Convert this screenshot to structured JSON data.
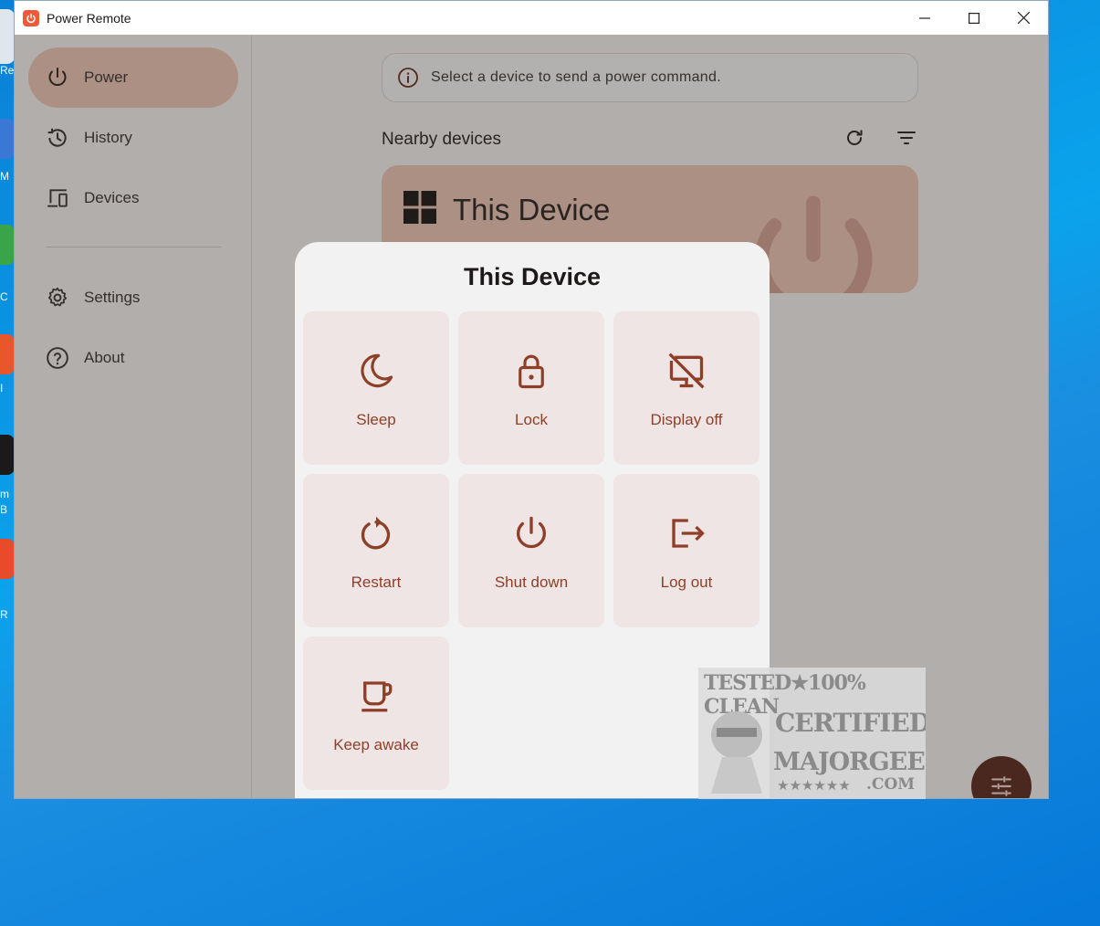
{
  "desktop": {
    "icon_labels": [
      "Re",
      "M",
      "C",
      "I",
      "m",
      "B",
      "R"
    ]
  },
  "window": {
    "title": "Power Remote",
    "controls": [
      "minimize",
      "maximize",
      "close"
    ]
  },
  "sidebar": {
    "items": [
      {
        "label": "Power",
        "icon": "power-icon",
        "active": true
      },
      {
        "label": "History",
        "icon": "history-icon",
        "active": false
      },
      {
        "label": "Devices",
        "icon": "devices-icon",
        "active": false
      },
      {
        "label": "Settings",
        "icon": "gear-icon",
        "active": false
      },
      {
        "label": "About",
        "icon": "help-circle-icon",
        "active": false
      }
    ]
  },
  "main": {
    "info_text": "Select a device to send a power command.",
    "section_title": "Nearby devices",
    "tools": [
      "refresh-icon",
      "filter-icon"
    ],
    "device_card": {
      "name": "This Device",
      "icon": "windows-logo-icon"
    }
  },
  "dialog": {
    "title": "This Device",
    "actions": [
      {
        "label": "Sleep",
        "icon": "moon-icon"
      },
      {
        "label": "Lock",
        "icon": "lock-icon"
      },
      {
        "label": "Display off",
        "icon": "display-off-icon"
      },
      {
        "label": "Restart",
        "icon": "restart-icon"
      },
      {
        "label": "Shut down",
        "icon": "power-icon"
      },
      {
        "label": "Log out",
        "icon": "logout-icon"
      },
      {
        "label": "Keep awake",
        "icon": "coffee-icon"
      }
    ]
  },
  "fab": {
    "icon": "tune-icon"
  },
  "watermark": {
    "line1": "TESTED★100% CLEAN",
    "line2": "CERTIFIED",
    "line3": "MAJORGEEKS",
    "line4": "★★★★★★",
    "line5": ".COM"
  },
  "colors": {
    "accent": "#8e3f28",
    "accent_light": "#f0c8b8",
    "tile_bg": "#efe5e4",
    "fab_bg": "#5b2a1f",
    "desktop_blue": "#0aa3ec"
  }
}
